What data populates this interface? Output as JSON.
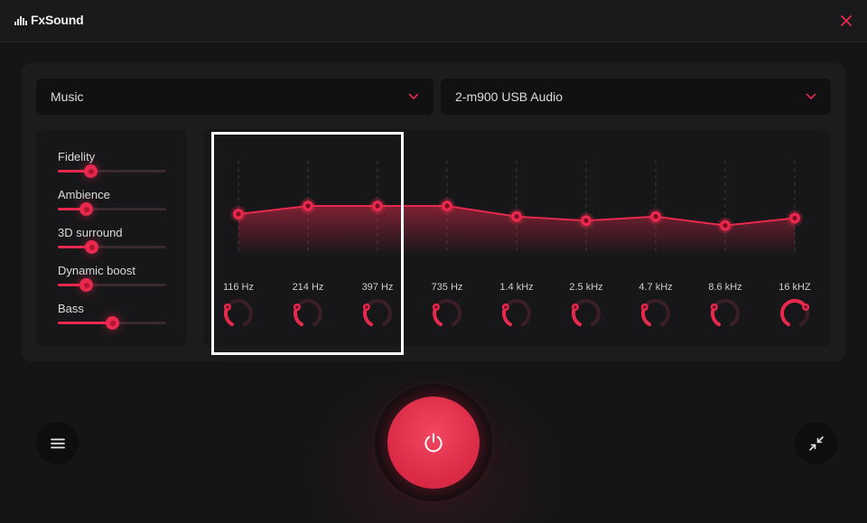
{
  "app": {
    "name": "FxSound",
    "close_icon": "close-icon",
    "accent_color": "#e8294d"
  },
  "preset": {
    "selected": "Music"
  },
  "output_device": {
    "selected": "2-m900 USB Audio"
  },
  "effects": [
    {
      "label": "Fidelity",
      "value": 0.3
    },
    {
      "label": "Ambience",
      "value": 0.26
    },
    {
      "label": "3D surround",
      "value": 0.31
    },
    {
      "label": "Dynamic boost",
      "value": 0.26
    },
    {
      "label": "Bass",
      "value": 0.5
    }
  ],
  "equalizer": {
    "bands": [
      {
        "label": "116 Hz",
        "gain": 0.0,
        "knob": 0.3
      },
      {
        "label": "214 Hz",
        "gain": 1.0,
        "knob": 0.3
      },
      {
        "label": "397 Hz",
        "gain": 1.0,
        "knob": 0.3
      },
      {
        "label": "735 Hz",
        "gain": 1.0,
        "knob": 0.3
      },
      {
        "label": "1.4 kHz",
        "gain": -0.3,
        "knob": 0.3
      },
      {
        "label": "2.5 kHz",
        "gain": -0.8,
        "knob": 0.3
      },
      {
        "label": "4.7 kHz",
        "gain": -0.3,
        "knob": 0.3
      },
      {
        "label": "8.6 kHz",
        "gain": -1.4,
        "knob": 0.3
      },
      {
        "label": "16 kHZ",
        "gain": -0.5,
        "knob": 0.7
      }
    ]
  },
  "controls": {
    "power_state": "on",
    "menu_icon": "hamburger-menu-icon",
    "power_icon": "power-icon",
    "minimize_icon": "minimize-arrows-icon"
  }
}
